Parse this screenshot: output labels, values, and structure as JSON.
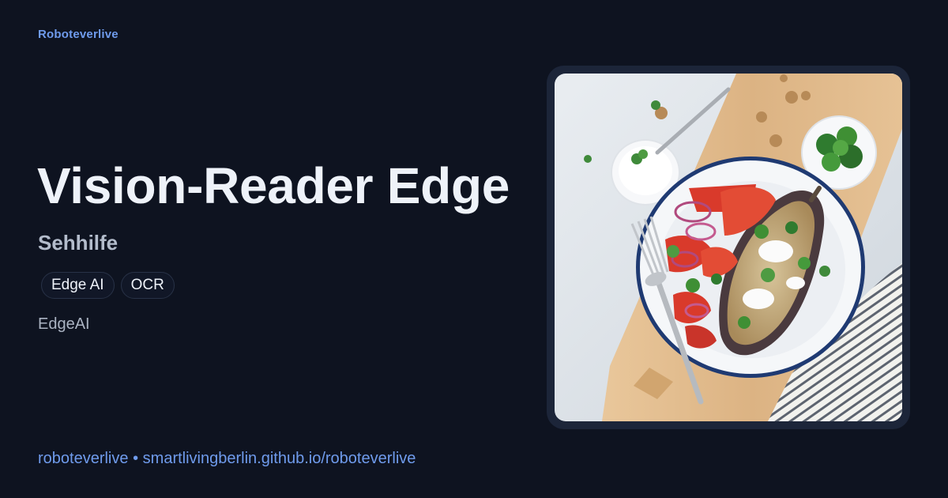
{
  "brand": "Roboteverlive",
  "title": "Vision-Reader Edge",
  "subtitle": "Sehhilfe",
  "tags": [
    "Edge AI",
    "OCR"
  ],
  "category": "EdgeAI",
  "footer": {
    "author": "roboteverlive",
    "separator": "•",
    "url": "smartlivingberlin.github.io/roboteverlive"
  },
  "colors": {
    "background": "#0e1320",
    "accent": "#6f9bec",
    "title": "#eef2f9",
    "frame": "#1c2539"
  },
  "image": {
    "subject": "plate-of-stuffed-eggplant-salad"
  }
}
